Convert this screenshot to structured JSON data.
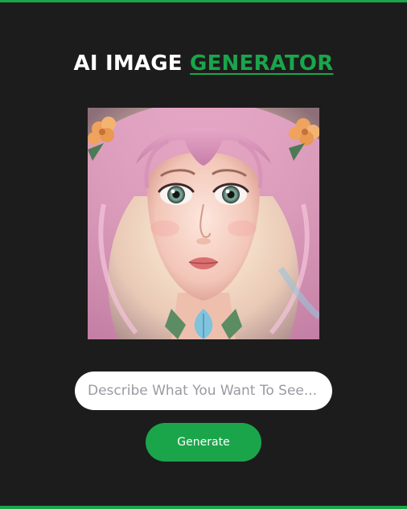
{
  "header": {
    "title_main": "AI IMAGE",
    "title_accent": "GENERATOR"
  },
  "image": {
    "alt": "AI generated portrait"
  },
  "prompt": {
    "value": "",
    "placeholder": "Describe What You Want To See..."
  },
  "actions": {
    "generate_label": "Generate"
  },
  "colors": {
    "background": "#1d1c1c",
    "accent": "#1aa54b",
    "text": "#ffffff"
  }
}
